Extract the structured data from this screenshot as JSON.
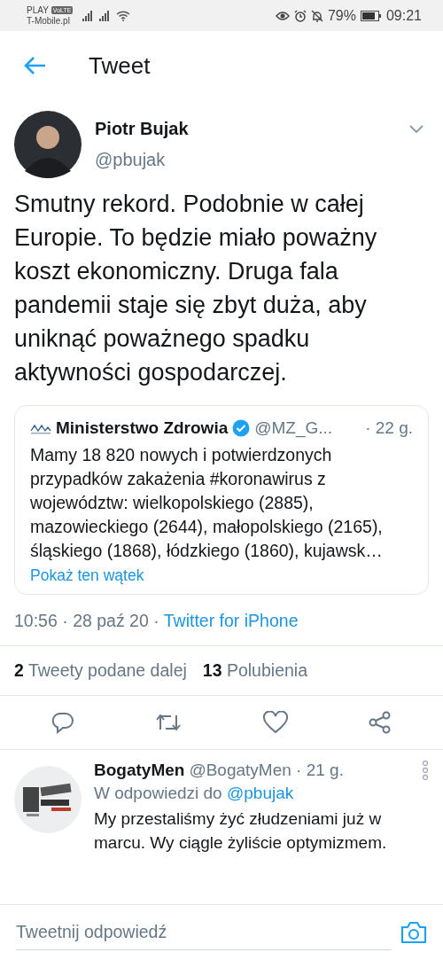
{
  "status_bar": {
    "carrier_1": "PLAY",
    "volte": "VoLTE",
    "carrier_2": "T-Mobile.pl",
    "battery": "79%",
    "time": "09:21"
  },
  "header": {
    "title": "Tweet"
  },
  "tweet": {
    "author": "Piotr Bujak",
    "handle": "@pbujak",
    "text": "Smutny rekord. Podobnie w całej Europie. To będzie miało poważny koszt ekonomiczny. Druga fala pandemii staje się zbyt duża, aby uniknąć poważnego spadku aktywności gospodarczej.",
    "quote": {
      "author": "Ministerstwo Zdrowia",
      "verified": true,
      "handle": "@MZ_G...",
      "time": "· 22 g.",
      "text": "Mamy 18 820 nowych i potwierdzonych przypadków zakażenia #koronawirus z województw: wielkopolskiego (2885), mazowieckiego (2644), małopolskiego (2165), śląskiego (1868), łódzkiego (1860), kujawsk…",
      "link": "Pokaż ten wątek"
    },
    "meta": "10:56 · 28 paź 20 · ",
    "source": "Twitter for iPhone",
    "stats": [
      {
        "count": "2",
        "label": "Tweety podane dalej"
      },
      {
        "count": "13",
        "label": "Polubienia"
      }
    ]
  },
  "reply": {
    "author": "BogatyMen",
    "handle": "@BogatyMen",
    "time": "· 21 g.",
    "in_reply_prefix": "W odpowiedzi do ",
    "in_reply_to": "@pbujak",
    "text": "My przestaliśmy żyć złudzeniami już w marcu. Wy ciągle żyliście optymizmem."
  },
  "compose": {
    "placeholder": "Tweetnij odpowiedź"
  }
}
